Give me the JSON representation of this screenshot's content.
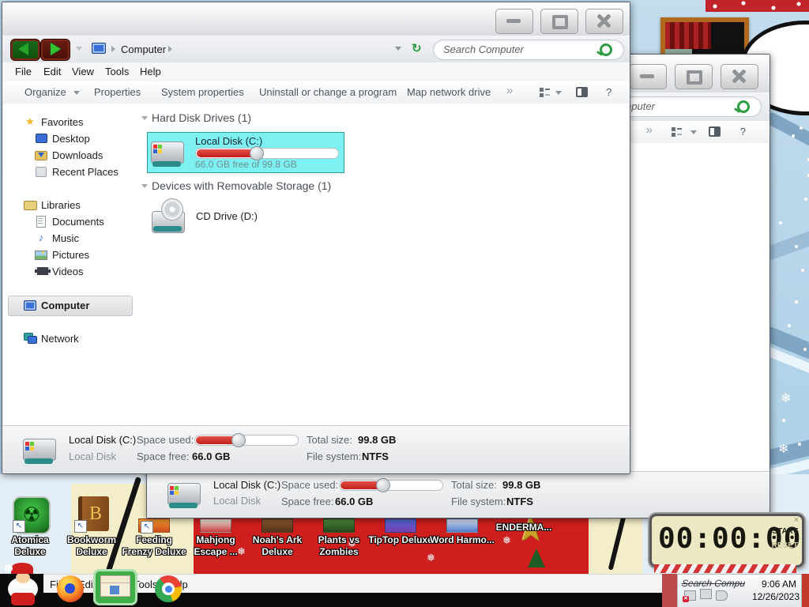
{
  "colors": {
    "selection_cyan": "#7df0f2",
    "selection_border": "#2f9d9d",
    "capacity_bar_red": "#d22b24",
    "accent_green": "#2f9e42",
    "desktop_band_red": "#ce1e1e",
    "taskbar_black": "#0b0b0b"
  },
  "explorer": {
    "breadcrumb": "Computer",
    "search_placeholder": "Search Computer",
    "menu": [
      "File",
      "Edit",
      "View",
      "Tools",
      "Help"
    ],
    "toolbar": {
      "organize": "Organize",
      "properties": "Properties",
      "system_properties": "System properties",
      "uninstall": "Uninstall or change a program",
      "map_drive": "Map network drive",
      "overflow": "»",
      "help": "?"
    },
    "sidebar": {
      "favorites": {
        "label": "Favorites",
        "items": [
          "Desktop",
          "Downloads",
          "Recent Places"
        ]
      },
      "libraries": {
        "label": "Libraries",
        "items": [
          "Documents",
          "Music",
          "Pictures",
          "Videos"
        ]
      },
      "computer": "Computer",
      "network": "Network"
    },
    "groups": {
      "hdd": "Hard Disk Drives (1)",
      "removable": "Devices with Removable Storage (1)"
    },
    "local_disk": {
      "name": "Local Disk (C:)",
      "free_text": "66.0 GB free of 99.8 GB",
      "bar_percent": 42
    },
    "cd_drive": {
      "name": "CD Drive (D:)"
    },
    "details": {
      "name": "Local Disk (C:)",
      "type": "Local Disk",
      "space_used_label": "Space used:",
      "space_free_label": "Space free:",
      "space_free": "66.0 GB",
      "total_label": "Total size:",
      "total": "99.8 GB",
      "fs_label": "File system:",
      "fs": "NTFS"
    }
  },
  "window2": {
    "search_text": "Search Computer",
    "overflow": "»",
    "help": "?"
  },
  "desktop_icons": [
    {
      "label": "Atomica Deluxe"
    },
    {
      "label": "Bookworm Deluxe"
    },
    {
      "label": "Feeding Frenzy Deluxe"
    },
    {
      "label": "Mahjong Escape ..."
    },
    {
      "label": "Noah's Ark Deluxe"
    },
    {
      "label": "Plants vs Zombies"
    },
    {
      "label": "TipTop Deluxe"
    },
    {
      "label": "Word Harmo..."
    },
    {
      "label": "ENDERMA..."
    }
  ],
  "clock_widget": {
    "time": "00:00:00",
    "start": "START",
    "reset": "RESET",
    "close": "×"
  },
  "taskbar": {
    "menu": [
      "File",
      "Edit",
      "Tools",
      "Help"
    ],
    "tray_search": "Search Compu",
    "time": "9:06 AM",
    "date": "12/26/2023"
  }
}
